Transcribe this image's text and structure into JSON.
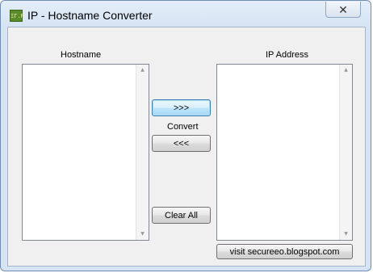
{
  "window": {
    "title": "IP - Hostname Converter",
    "icon_text": "ΞΓ.R",
    "close_glyph": "✕"
  },
  "hostname": {
    "label": "Hostname"
  },
  "ip": {
    "label": "IP Address"
  },
  "buttons": {
    "to_ip": ">>>",
    "convert_label": "Convert",
    "to_hostname": "<<<",
    "clear": "Clear All",
    "visit": "visit secureeo.blogspot.com"
  },
  "scroll": {
    "up": "▲",
    "down": "▼"
  }
}
